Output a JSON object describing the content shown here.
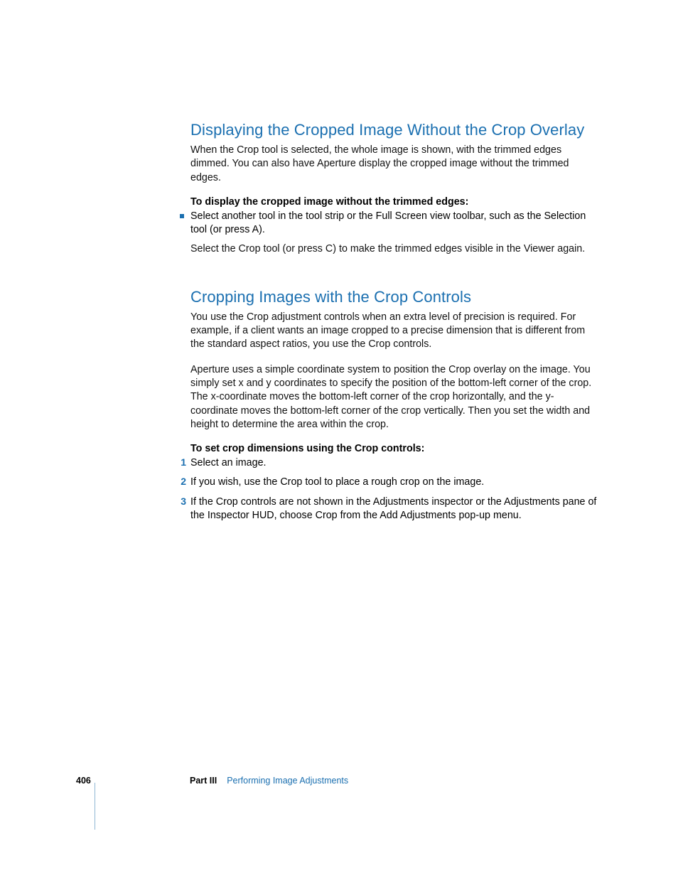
{
  "section1": {
    "heading": "Displaying the Cropped Image Without the Crop Overlay",
    "intro": "When the Crop tool is selected, the whole image is shown, with the trimmed edges dimmed. You can also have Aperture display the cropped image without the trimmed edges.",
    "bold_lead": "To display the cropped image without the trimmed edges:",
    "bullet": "Select another tool in the tool strip or the Full Screen view toolbar, such as the Selection tool (or press A).",
    "after_bullet": "Select the Crop tool (or press C) to make the trimmed edges visible in the Viewer again."
  },
  "section2": {
    "heading": "Cropping Images with the Crop Controls",
    "para1": "You use the Crop adjustment controls when an extra level of precision is required. For example, if a client wants an image cropped to a precise dimension that is different from the standard aspect ratios, you use the Crop controls.",
    "para2": "Aperture uses a simple coordinate system to position the Crop overlay on the image. You simply set x and y coordinates to specify the position of the bottom-left corner of the crop. The x-coordinate moves the bottom-left corner of the crop horizontally, and the y-coordinate moves the bottom-left corner of the crop vertically. Then you set the width and height to determine the area within the crop.",
    "bold_lead": "To set crop dimensions using the Crop controls:",
    "steps": [
      "Select an image.",
      "If you wish, use the Crop tool to place a rough crop on the image.",
      "If the Crop controls are not shown in the Adjustments inspector or the Adjustments pane of the Inspector HUD, choose Crop from the Add Adjustments pop-up menu."
    ]
  },
  "footer": {
    "page_number": "406",
    "part_label": "Part III",
    "part_title": "Performing Image Adjustments"
  },
  "markers": {
    "n1": "1",
    "n2": "2",
    "n3": "3"
  }
}
